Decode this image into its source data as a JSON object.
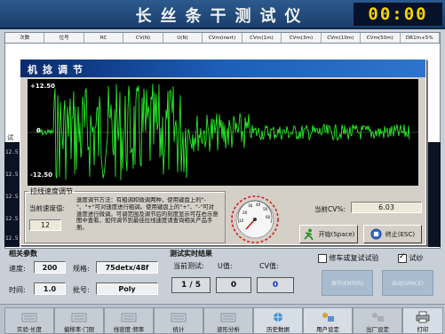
{
  "app": {
    "title": "长丝条干测试仪",
    "clock": "00:00"
  },
  "table": {
    "headers": [
      "次数",
      "位号",
      "RC",
      "CV(N)",
      "U(N)",
      "CVm(inert)",
      "CVm(1m)",
      "CVm(3m)",
      "CVm(10m)",
      "CVm(50m)",
      "DR1m+5%"
    ],
    "side_labels": [
      "试",
      "12.5",
      "12.5",
      "12.5",
      "12.5",
      "12.5"
    ]
  },
  "dialog": {
    "title": "机捻调节",
    "scope": {
      "top_label": "+12.50",
      "mid_label": "0",
      "bottom_label": "-12.50"
    },
    "speed_group": {
      "legend": "拉线速度调节",
      "current_speed_label": "当前速度值:",
      "current_speed_value": "12",
      "help_text": "速度调节方法：有粗调和微调两种，使用键盘上的\"-\"、\"+\"可对速度进行粗调。使用键盘上的\"+\"、\"-\"可对速度进行微调。可调范围及调节后的刻度显示可在右示意图中查看，如何调节到最佳拉线速度请查询相关产品手册。"
    },
    "gauge": {
      "ticks": [
        "20",
        "30",
        "40",
        "50",
        "60",
        "10"
      ]
    },
    "cv_label": "当前CV%:",
    "cv_value": "6.03",
    "start_button": "开始(Space)",
    "stop_button": "终止(ESC)"
  },
  "params": {
    "title": "相关参数",
    "speed_label": "速度:",
    "speed_value": "200",
    "spec_label": "规格:",
    "spec_value": "75detx/48f",
    "time_label": "时间:",
    "time_value": "1.0",
    "batch_label": "批号:",
    "batch_value": "Poly"
  },
  "realtime": {
    "title": "测试实时结果",
    "current_test_label": "当前测试:",
    "u_label": "U值:",
    "cv_label": "CV值:",
    "current_test_value": "1 / 5",
    "u_value": "0",
    "cv_value": "0"
  },
  "options": {
    "retest_label": "修车或复试试验",
    "retest_checked": false,
    "test_yarn_label": "试纱",
    "test_yarn_checked": true,
    "btn_left": "调节(ENTER)",
    "btn_right": "启动(SPACE)"
  },
  "toolbar": [
    {
      "label": "实验·长度",
      "state": "disabled",
      "icon": "keyboard-icon"
    },
    {
      "label": "偏移率·门限",
      "state": "disabled",
      "icon": "keyboard-icon"
    },
    {
      "label": "线密度·频率",
      "state": "disabled",
      "icon": "keyboard-icon"
    },
    {
      "label": "统计",
      "state": "disabled",
      "icon": "keyboard-icon"
    },
    {
      "label": "波形分析",
      "state": "disabled",
      "icon": "keyboard-icon"
    },
    {
      "label": "历史数据",
      "state": "enabled",
      "icon": "network-icon"
    },
    {
      "label": "用户设定",
      "state": "enabled",
      "icon": "settings-icon"
    },
    {
      "label": "出厂设定",
      "state": "disabled",
      "icon": "settings-icon"
    },
    {
      "label": "打印",
      "state": "enabled",
      "icon": "printer-icon"
    }
  ],
  "colors": {
    "signal": "#2cff2c",
    "title_bar": "#1b3f6b",
    "clock_digits": "#ffd200",
    "cv_value": "#1030c0"
  }
}
